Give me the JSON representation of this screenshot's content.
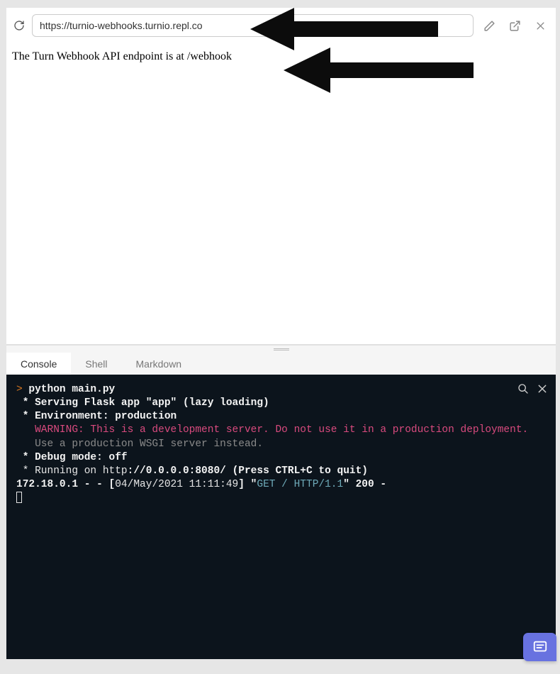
{
  "browser": {
    "url": "https://turnio-webhooks.turnio.repl.co",
    "page_text": "The Turn Webhook API endpoint is at /webhook"
  },
  "tabs": [
    {
      "label": "Console",
      "active": true
    },
    {
      "label": "Shell",
      "active": false
    },
    {
      "label": "Markdown",
      "active": false
    }
  ],
  "console": {
    "prompt": ">",
    "command": "python main.py",
    "lines": {
      "l1": " * Serving Flask app \"app\" (lazy loading)",
      "l2": " * Environment: production",
      "l3_warn": "   WARNING: This is a development server. Do not use it in a production deployment.",
      "l4_dim": "   Use a production WSGI server instead.",
      "l5": " * Debug mode: off",
      "l6a": " * Running on http",
      "l6b": "://0.0.0.0:8080/ (Press CTRL+C to quit)",
      "log_ip_a": "172.18.0.1 - - [",
      "log_date": "04/May/2021 11:11:49",
      "log_b": "] \"",
      "log_req": "GET / HTTP/1.1",
      "log_c": "\" ",
      "log_status": "200",
      "log_d": " -"
    }
  }
}
